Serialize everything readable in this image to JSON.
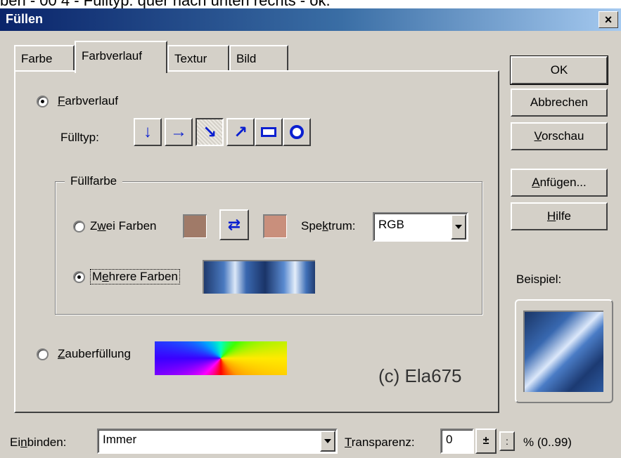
{
  "top_caption": "ben - 00 4 - Fülltyp: quer nach unten rechts - ok.",
  "window": {
    "title": "Füllen",
    "close_glyph": "×"
  },
  "tabs": [
    {
      "label": "Farbe",
      "active": false
    },
    {
      "label": "Farbverlauf",
      "active": true
    },
    {
      "label": "Textur",
      "active": false
    },
    {
      "label": "Bild",
      "active": false
    }
  ],
  "gradient": {
    "radio_label": "Farbverlauf",
    "checked": true,
    "filltype_label": "Fülltyp:",
    "filltype_buttons": [
      {
        "icon": "arrow-down-icon",
        "glyph": "↓"
      },
      {
        "icon": "arrow-right-icon",
        "glyph": "→"
      },
      {
        "icon": "arrow-down-right-icon",
        "glyph": "↘",
        "pressed": true
      },
      {
        "icon": "arrow-up-right-icon",
        "glyph": "↗"
      },
      {
        "icon": "rectangle-icon",
        "glyph": ""
      },
      {
        "icon": "circle-icon",
        "glyph": ""
      }
    ]
  },
  "fill_color": {
    "group_title": "Füllfarbe",
    "two_colors": {
      "label": "Zwei Farben",
      "checked": false,
      "color1": "#a07a68",
      "swap_glyph": "⇄",
      "color2": "#c98f7c",
      "spectrum_label": "Spektrum:",
      "spectrum_value": "RGB"
    },
    "multiple_colors": {
      "label": "Mehrere Farben",
      "checked": true
    }
  },
  "magic_fill": {
    "label": "Zauberfüllung",
    "checked": false
  },
  "watermark": "(c) Ela675",
  "buttons": {
    "ok": "OK",
    "cancel": "Abbrechen",
    "preview": "Vorschau",
    "apply": "Anfügen...",
    "help": "Hilfe"
  },
  "example_label": "Beispiel:",
  "footer": {
    "embed_label": "Einbinden:",
    "embed_value": "Immer",
    "transparency_label": "Transparenz:",
    "transparency_value": "0",
    "range_label": "% (0..99)"
  },
  "colors": {
    "title_bar_start": "#0a246a",
    "dialog_bg": "#d4d0c8",
    "icon_blue": "#0a1fd0"
  }
}
